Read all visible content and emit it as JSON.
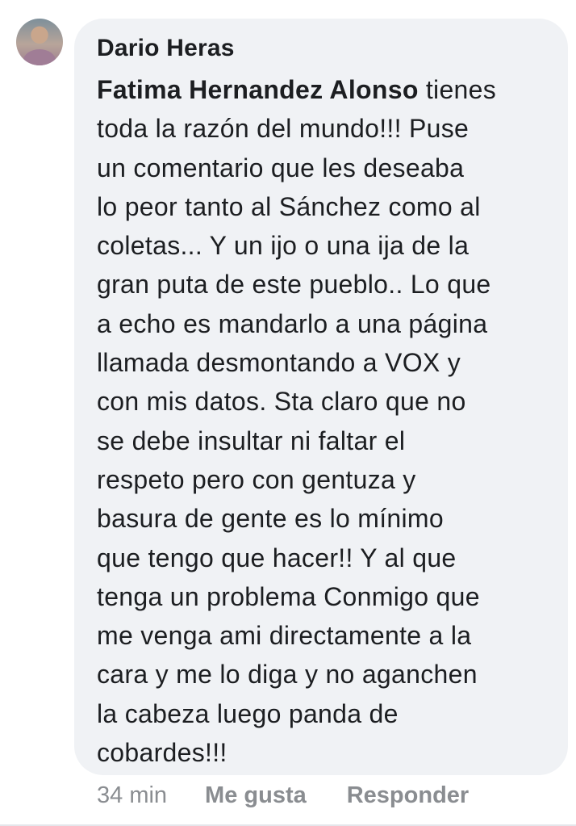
{
  "comment": {
    "author": "Dario Heras",
    "mention": "Fatima Hernandez Alonso",
    "first_line_rest": " tienes",
    "body": "toda la razón del mundo!!! Puse\nun comentario que les deseaba\nlo peor tanto al Sánchez como al\ncoletas... Y un ijo o una ija de la\ngran puta de este pueblo.. Lo que\na echo es mandarlo a una página\nllamada desmontando a VOX y\ncon mis datos. Sta claro que no\nse debe insultar ni faltar el\nrespeto pero con gentuza y\nbasura de gente es lo mínimo\nque tengo que hacer!! Y al que\ntenga un problema Conmigo que\nme venga ami directamente a la\ncara y me lo diga y no aganchen\nla cabeza luego panda de\ncobardes!!!",
    "timestamp": "34 min",
    "like_label": "Me gusta",
    "reply_label": "Responder"
  },
  "colors": {
    "bubble": "#f0f2f5",
    "text": "#1c1e21",
    "meta": "#8a8d91"
  }
}
